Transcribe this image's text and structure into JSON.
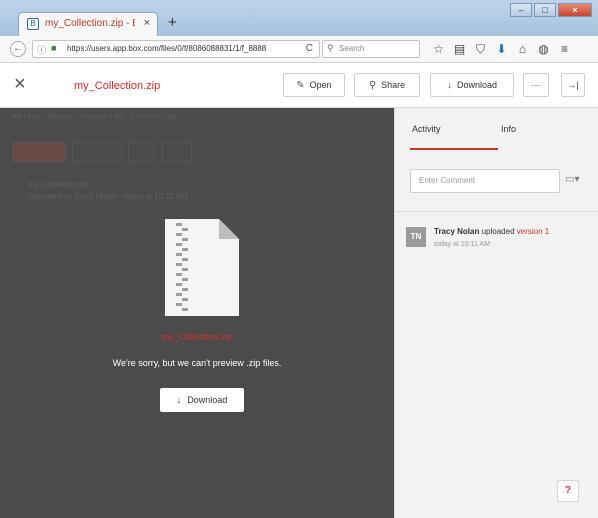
{
  "browser": {
    "tab_title": "my_Collection.zip - Box",
    "tab_favicon": "B",
    "tab_close": "×",
    "new_tab": "+",
    "window_controls": [
      "–",
      "□",
      "×"
    ],
    "url_info": "ⓘ",
    "url_lock": "🔒",
    "url": "https://users.app.box.com/files/0/f/8086088831/1/f_8888",
    "reload": "C",
    "search_placeholder": "Search",
    "toolbar_icons": [
      {
        "name": "bookmark-star-icon",
        "glyph": "☆",
        "color": "#444444"
      },
      {
        "name": "reading-list-icon",
        "glyph": "▤",
        "color": "#444444"
      },
      {
        "name": "pocket-icon",
        "glyph": "⛉",
        "color": "#444444"
      },
      {
        "name": "downloads-icon",
        "glyph": "⬇",
        "color": "#1d6fd1"
      },
      {
        "name": "home-icon",
        "glyph": "⌂",
        "color": "#444444"
      },
      {
        "name": "chat-icon",
        "glyph": "◍",
        "color": "#444444"
      },
      {
        "name": "menu-icon",
        "glyph": "≡",
        "color": "#444444"
      }
    ]
  },
  "header": {
    "close_glyph": "×",
    "file_name": "my_Collection.zip",
    "buttons": {
      "open": {
        "icon": "✎",
        "label": "Open"
      },
      "share": {
        "icon": "⚲",
        "label": "Share"
      },
      "download": {
        "icon": "↓",
        "label": "Download"
      },
      "more": {
        "label": "···"
      },
      "collapse": {
        "label": "→|"
      }
    }
  },
  "preview": {
    "background_breadcrumb": "All Files  ›  Shared  ›  Sample  ›  my_Collection.zip",
    "background_line_1": "my_Collection.zip",
    "background_line_2": "uploaded by Tracy Nolan · today at 10:11 AM",
    "filename": "my_Collection.zip",
    "message": "We're sorry, but we can't preview .zip files.",
    "download_icon": "↓",
    "download_label": "Download"
  },
  "sidebar": {
    "tabs": {
      "activity": "Activity",
      "info": "Info"
    },
    "comment_placeholder": "Enter Comment",
    "comment_icon": "▭▾",
    "activity": {
      "avatar": "TN",
      "user": "Tracy Nolan",
      "action": "uploaded",
      "version": "version 1",
      "time": "today at 10:11 AM"
    },
    "help_label": "?"
  },
  "colors": {
    "accent": "#c0392b",
    "preview_bg": "#4b4b4b",
    "filename_red": "#e02020",
    "sidebar_bg": "#f2f2f2"
  }
}
